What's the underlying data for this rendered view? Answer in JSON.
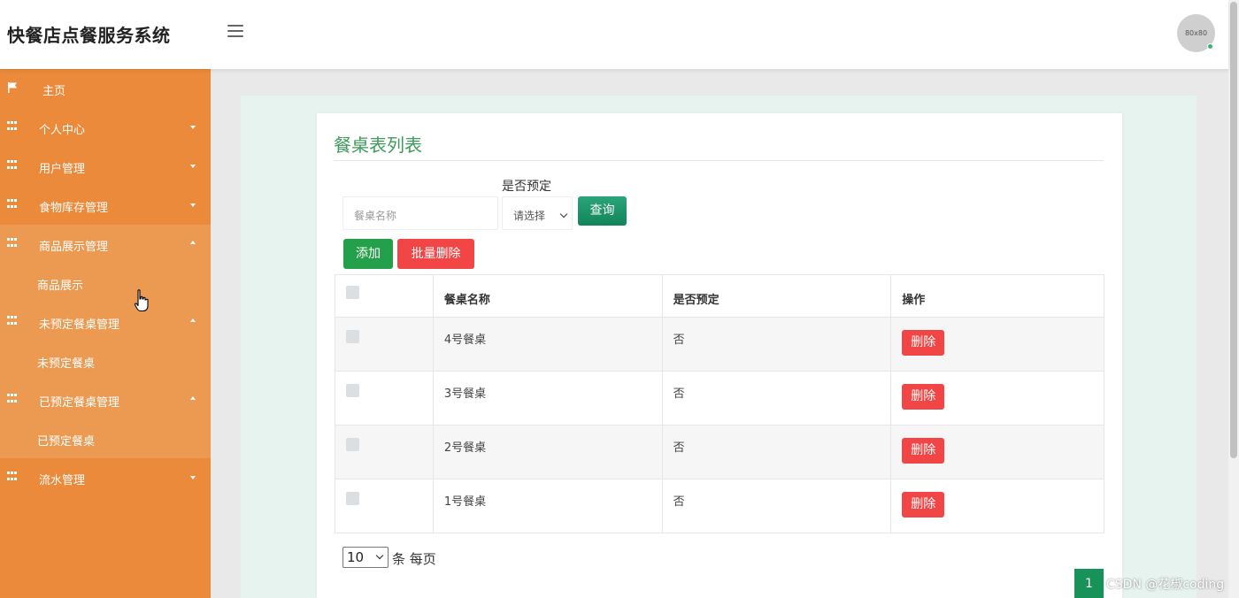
{
  "header": {
    "app_title": "快餐店点餐服务系统",
    "avatar_text": "80x80"
  },
  "sidebar": {
    "items": [
      {
        "label": "主页",
        "icon": "flag-icon"
      },
      {
        "label": "个人中心",
        "icon": "grid-icon"
      },
      {
        "label": "用户管理",
        "icon": "grid-icon"
      },
      {
        "label": "食物库存管理",
        "icon": "grid-icon"
      },
      {
        "label": "商品展示管理",
        "icon": "grid-icon"
      },
      {
        "label": "商品展示"
      },
      {
        "label": "未预定餐桌管理",
        "icon": "grid-icon"
      },
      {
        "label": "未预定餐桌"
      },
      {
        "label": "已预定餐桌管理",
        "icon": "grid-icon"
      },
      {
        "label": "已预定餐桌"
      },
      {
        "label": "流水管理",
        "icon": "grid-icon"
      }
    ]
  },
  "main": {
    "title": "餐桌表列表",
    "search": {
      "name_placeholder": "餐桌名称",
      "reserved_label": "是否预定",
      "reserved_select_value": "请选择",
      "query_label": "查询"
    },
    "actions": {
      "add_label": "添加",
      "batch_delete_label": "批量删除"
    },
    "table": {
      "columns": [
        "餐桌名称",
        "是否预定",
        "操作"
      ],
      "rows": [
        {
          "name": "4号餐桌",
          "reserved": "否",
          "action": "删除"
        },
        {
          "name": "3号餐桌",
          "reserved": "否",
          "action": "删除"
        },
        {
          "name": "2号餐桌",
          "reserved": "否",
          "action": "删除"
        },
        {
          "name": "1号餐桌",
          "reserved": "否",
          "action": "删除"
        }
      ]
    },
    "pagination": {
      "page_size": "10",
      "page_size_label": "条 每页",
      "current_page": "1"
    }
  },
  "watermark": "CSDN @花椒coding",
  "colors": {
    "sidebar": "#eb8a3a",
    "accent_green": "#3d9a5a",
    "danger": "#f24545"
  }
}
